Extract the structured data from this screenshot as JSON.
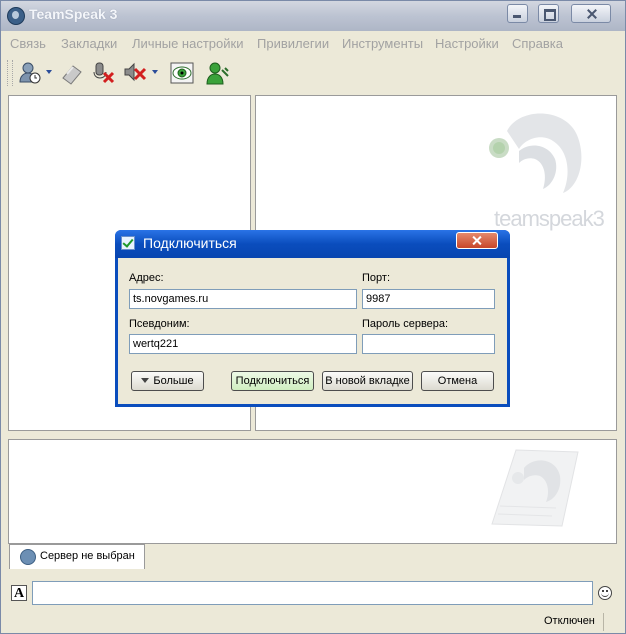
{
  "window": {
    "title": "TeamSpeak 3"
  },
  "menu": {
    "items": [
      "Связь",
      "Закладки",
      "Личные настройки",
      "Привилегии",
      "Инструменты",
      "Настройки",
      "Справка"
    ]
  },
  "toolbar": {
    "icons": [
      "away-icon",
      "bookmark-icon",
      "mute-mic-icon",
      "mute-speakers-icon",
      "channel-view-icon",
      "identity-icon"
    ]
  },
  "tabs": {
    "server_tab": "Сервер не выбран"
  },
  "status": {
    "text": "Отключен"
  },
  "dialog": {
    "title": "Подключиться",
    "address_label": "Адрес:",
    "address_value": "ts.novgames.ru",
    "port_label": "Порт:",
    "port_value": "9987",
    "nickname_label": "Псевдоним:",
    "nickname_value": "wertq221",
    "password_label": "Пароль сервера:",
    "password_value": "",
    "more_button": "Больше",
    "connect_button": "Подключиться",
    "new_tab_button": "В новой вкладке",
    "cancel_button": "Отмена"
  },
  "colors": {
    "dialog_title": "#0a4dbd",
    "connect_button": "#cfeec0",
    "menu_disabled_text": "#a2a2a2"
  }
}
